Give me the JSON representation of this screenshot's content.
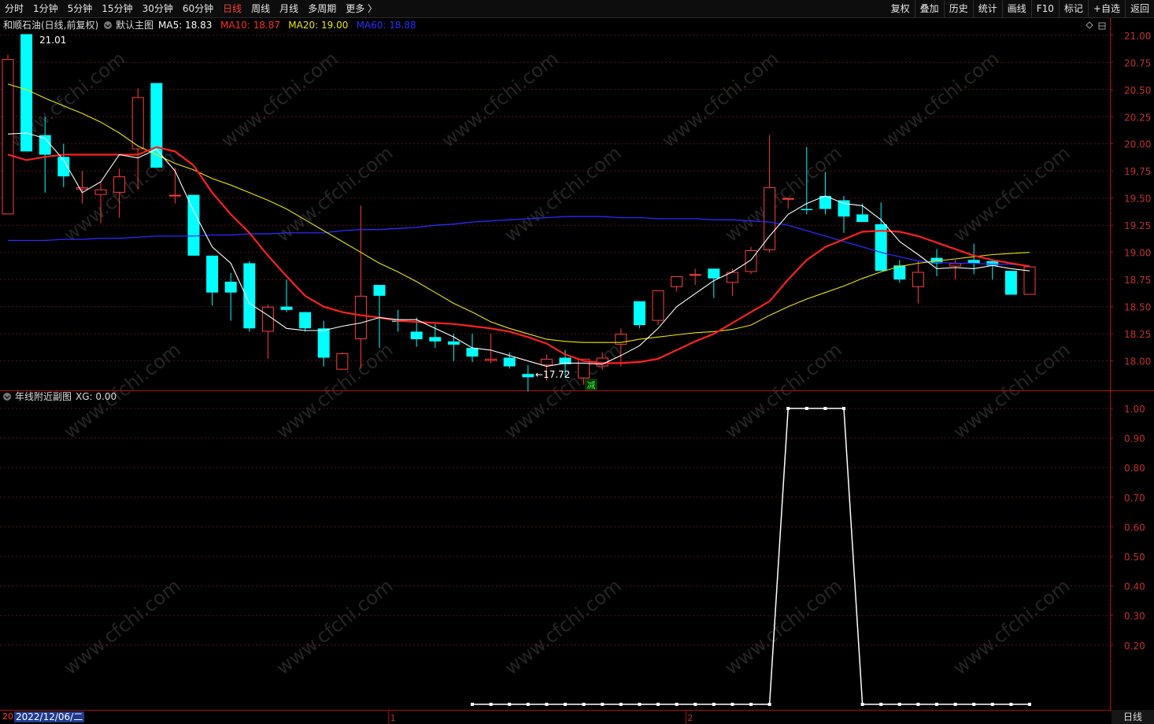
{
  "toolbar": {
    "periods": [
      "分时",
      "1分钟",
      "5分钟",
      "15分钟",
      "30分钟",
      "60分钟",
      "日线",
      "周线",
      "月线",
      "多周期",
      "更多 〉"
    ],
    "active_period": "日线",
    "actions": [
      "复权",
      "叠加",
      "历史",
      "统计",
      "画线",
      "F10",
      "标记",
      "+自选",
      "返回"
    ]
  },
  "main_panel": {
    "stock_title": "和顺石油(日线,前复权)",
    "template_name": "默认主图",
    "ma_labels": [
      {
        "text": "MA5: 18.83",
        "color": "#ffffff"
      },
      {
        "text": "MA10: 18.87",
        "color": "#ff2a2a"
      },
      {
        "text": "MA20: 19.00",
        "color": "#e8e800"
      },
      {
        "text": "MA60: 18.88",
        "color": "#2c2cff"
      }
    ],
    "high_marker": "21.01",
    "low_marker": "←17.72",
    "reduce_tag": "减"
  },
  "sub_panel": {
    "title": "年线附近副图",
    "value_text": "XG: 0.00"
  },
  "bottom": {
    "date_prefix": "20",
    "date_label": "2022/12/06/二",
    "month_marks": [
      "1",
      "2"
    ],
    "period_label": "日线"
  },
  "watermark": "www.cfchi.com",
  "chart_data": [
    {
      "type": "candlestick",
      "y_axis_ticks": [
        "21.00",
        "20.75",
        "20.50",
        "20.25",
        "20.00",
        "19.75",
        "19.50",
        "19.25",
        "19.00",
        "18.75",
        "18.50",
        "18.25",
        "18.00"
      ],
      "ylim": [
        17.78,
        21.1
      ],
      "candles": [
        {
          "o": 19.35,
          "h": 20.82,
          "l": 19.35,
          "c": 20.78,
          "dir": "up"
        },
        {
          "o": 21.01,
          "h": 21.01,
          "l": 19.93,
          "c": 19.93,
          "dir": "down"
        },
        {
          "o": 20.08,
          "h": 20.25,
          "l": 19.55,
          "c": 19.9,
          "dir": "down"
        },
        {
          "o": 19.88,
          "h": 20.0,
          "l": 19.6,
          "c": 19.7,
          "dir": "down"
        },
        {
          "o": 19.6,
          "h": 19.75,
          "l": 19.45,
          "c": 19.58,
          "dir": "up"
        },
        {
          "o": 19.53,
          "h": 19.65,
          "l": 19.27,
          "c": 19.58,
          "dir": "up"
        },
        {
          "o": 19.55,
          "h": 19.77,
          "l": 19.32,
          "c": 19.7,
          "dir": "up"
        },
        {
          "o": 19.95,
          "h": 20.51,
          "l": 19.58,
          "c": 20.43,
          "dir": "up"
        },
        {
          "o": 20.56,
          "h": 20.56,
          "l": 19.78,
          "c": 19.78,
          "dir": "down"
        },
        {
          "o": 19.52,
          "h": 19.78,
          "l": 19.45,
          "c": 19.53,
          "dir": "up"
        },
        {
          "o": 19.53,
          "h": 19.53,
          "l": 18.97,
          "c": 18.97,
          "dir": "down"
        },
        {
          "o": 18.97,
          "h": 18.97,
          "l": 18.51,
          "c": 18.63,
          "dir": "down"
        },
        {
          "o": 18.73,
          "h": 18.81,
          "l": 18.37,
          "c": 18.63,
          "dir": "down"
        },
        {
          "o": 18.9,
          "h": 18.92,
          "l": 18.27,
          "c": 18.3,
          "dir": "down"
        },
        {
          "o": 18.27,
          "h": 18.52,
          "l": 18.02,
          "c": 18.5,
          "dir": "up"
        },
        {
          "o": 18.5,
          "h": 18.75,
          "l": 18.45,
          "c": 18.47,
          "dir": "down"
        },
        {
          "o": 18.45,
          "h": 18.45,
          "l": 18.27,
          "c": 18.3,
          "dir": "down"
        },
        {
          "o": 18.3,
          "h": 18.37,
          "l": 17.95,
          "c": 18.03,
          "dir": "down"
        },
        {
          "o": 17.92,
          "h": 18.08,
          "l": 17.92,
          "c": 18.07,
          "dir": "up"
        },
        {
          "o": 18.2,
          "h": 19.43,
          "l": 17.93,
          "c": 18.6,
          "dir": "up"
        },
        {
          "o": 18.7,
          "h": 18.7,
          "l": 18.12,
          "c": 18.6,
          "dir": "down"
        },
        {
          "o": 18.37,
          "h": 18.47,
          "l": 18.27,
          "c": 18.37,
          "dir": "down"
        },
        {
          "o": 18.27,
          "h": 18.4,
          "l": 18.13,
          "c": 18.2,
          "dir": "down"
        },
        {
          "o": 18.22,
          "h": 18.34,
          "l": 18.12,
          "c": 18.18,
          "dir": "down"
        },
        {
          "o": 18.18,
          "h": 18.25,
          "l": 18.0,
          "c": 18.15,
          "dir": "down"
        },
        {
          "o": 18.12,
          "h": 18.25,
          "l": 17.99,
          "c": 18.04,
          "dir": "down"
        },
        {
          "o": 18.0,
          "h": 18.25,
          "l": 17.98,
          "c": 18.02,
          "dir": "up"
        },
        {
          "o": 18.03,
          "h": 18.08,
          "l": 17.93,
          "c": 17.95,
          "dir": "down"
        },
        {
          "o": 17.88,
          "h": 17.96,
          "l": 17.72,
          "c": 17.85,
          "dir": "down"
        },
        {
          "o": 17.96,
          "h": 18.06,
          "l": 17.82,
          "c": 18.02,
          "dir": "up"
        },
        {
          "o": 18.03,
          "h": 18.1,
          "l": 17.85,
          "c": 17.97,
          "dir": "down"
        },
        {
          "o": 17.84,
          "h": 18.02,
          "l": 17.78,
          "c": 18.02,
          "dir": "up"
        },
        {
          "o": 18.03,
          "h": 18.08,
          "l": 17.92,
          "c": 17.95,
          "dir": "up"
        },
        {
          "o": 18.15,
          "h": 18.3,
          "l": 17.95,
          "c": 18.25,
          "dir": "up"
        },
        {
          "o": 18.33,
          "h": 18.55,
          "l": 18.3,
          "c": 18.55,
          "dir": "down"
        },
        {
          "o": 18.37,
          "h": 18.65,
          "l": 18.33,
          "c": 18.65,
          "dir": "up"
        },
        {
          "o": 18.68,
          "h": 18.78,
          "l": 18.64,
          "c": 18.78,
          "dir": "up"
        },
        {
          "o": 18.8,
          "h": 18.85,
          "l": 18.7,
          "c": 18.8,
          "dir": "up"
        },
        {
          "o": 18.85,
          "h": 18.85,
          "l": 18.58,
          "c": 18.76,
          "dir": "down"
        },
        {
          "o": 18.72,
          "h": 18.85,
          "l": 18.6,
          "c": 18.82,
          "dir": "up"
        },
        {
          "o": 18.82,
          "h": 19.05,
          "l": 18.8,
          "c": 19.02,
          "dir": "up"
        },
        {
          "o": 19.02,
          "h": 20.08,
          "l": 19.0,
          "c": 19.6,
          "dir": "up"
        },
        {
          "o": 19.5,
          "h": 19.5,
          "l": 19.4,
          "c": 19.5,
          "dir": "up"
        },
        {
          "o": 19.4,
          "h": 19.97,
          "l": 19.35,
          "c": 19.4,
          "dir": "down"
        },
        {
          "o": 19.52,
          "h": 19.74,
          "l": 19.35,
          "c": 19.4,
          "dir": "down"
        },
        {
          "o": 19.48,
          "h": 19.52,
          "l": 19.18,
          "c": 19.33,
          "dir": "down"
        },
        {
          "o": 19.35,
          "h": 19.45,
          "l": 19.28,
          "c": 19.28,
          "dir": "down"
        },
        {
          "o": 19.26,
          "h": 19.46,
          "l": 18.83,
          "c": 18.83,
          "dir": "down"
        },
        {
          "o": 18.88,
          "h": 18.93,
          "l": 18.72,
          "c": 18.75,
          "dir": "down"
        },
        {
          "o": 18.68,
          "h": 18.92,
          "l": 18.53,
          "c": 18.82,
          "dir": "up"
        },
        {
          "o": 18.95,
          "h": 19.03,
          "l": 18.78,
          "c": 18.9,
          "dir": "down"
        },
        {
          "o": 18.87,
          "h": 18.93,
          "l": 18.75,
          "c": 18.9,
          "dir": "up"
        },
        {
          "o": 18.93,
          "h": 19.08,
          "l": 18.8,
          "c": 18.9,
          "dir": "down"
        },
        {
          "o": 18.92,
          "h": 18.92,
          "l": 18.75,
          "c": 18.88,
          "dir": "down"
        },
        {
          "o": 18.83,
          "h": 18.83,
          "l": 18.61,
          "c": 18.61,
          "dir": "down"
        },
        {
          "o": 18.61,
          "h": 18.87,
          "l": 18.61,
          "c": 18.87,
          "dir": "up"
        }
      ],
      "ma5": [
        20.09,
        20.1,
        20.05,
        19.85,
        19.55,
        19.65,
        19.9,
        19.87,
        19.95,
        19.75,
        19.38,
        19.05,
        18.9,
        18.53,
        18.42,
        18.3,
        18.28,
        18.28,
        18.32,
        18.35,
        18.4,
        18.38,
        18.38,
        18.3,
        18.22,
        18.12,
        18.1,
        18.05,
        18.0,
        17.95,
        17.98,
        17.98,
        17.97,
        18.05,
        18.14,
        18.3,
        18.5,
        18.62,
        18.74,
        18.82,
        18.93,
        19.15,
        19.35,
        19.45,
        19.52,
        19.45,
        19.43,
        19.3,
        19.1,
        18.98,
        18.85,
        18.86,
        18.85,
        18.88,
        18.85,
        18.83
      ],
      "ma10": [
        19.9,
        19.85,
        19.88,
        19.9,
        19.9,
        19.9,
        19.9,
        19.9,
        19.97,
        19.93,
        19.8,
        19.55,
        19.35,
        19.18,
        18.97,
        18.78,
        18.6,
        18.5,
        18.45,
        18.42,
        18.4,
        18.37,
        18.36,
        18.35,
        18.34,
        18.32,
        18.3,
        18.27,
        18.22,
        18.16,
        18.06,
        18.0,
        17.98,
        17.98,
        17.99,
        18.02,
        18.1,
        18.18,
        18.25,
        18.35,
        18.45,
        18.55,
        18.75,
        18.93,
        19.05,
        19.12,
        19.19,
        19.2,
        19.19,
        19.15,
        19.09,
        19.03,
        18.97,
        18.93,
        18.9,
        18.87
      ],
      "ma20": [
        20.55,
        20.5,
        20.42,
        20.35,
        20.28,
        20.2,
        20.1,
        19.98,
        19.9,
        19.82,
        19.76,
        19.68,
        19.62,
        19.55,
        19.48,
        19.4,
        19.3,
        19.2,
        19.1,
        19.0,
        18.9,
        18.82,
        18.73,
        18.63,
        18.53,
        18.45,
        18.36,
        18.3,
        18.25,
        18.2,
        18.18,
        18.17,
        18.17,
        18.17,
        18.2,
        18.22,
        18.24,
        18.26,
        18.27,
        18.29,
        18.33,
        18.42,
        18.5,
        18.57,
        18.63,
        18.69,
        18.76,
        18.82,
        18.87,
        18.9,
        18.92,
        18.94,
        18.96,
        18.98,
        18.99,
        19.0
      ],
      "ma60": [
        19.11,
        19.11,
        19.11,
        19.12,
        19.12,
        19.13,
        19.13,
        19.14,
        19.15,
        19.15,
        19.15,
        19.16,
        19.16,
        19.17,
        19.17,
        19.18,
        19.18,
        19.18,
        19.2,
        19.21,
        19.21,
        19.22,
        19.23,
        19.25,
        19.26,
        19.28,
        19.29,
        19.3,
        19.31,
        19.32,
        19.33,
        19.33,
        19.33,
        19.32,
        19.32,
        19.31,
        19.31,
        19.31,
        19.3,
        19.3,
        19.29,
        19.28,
        19.25,
        19.2,
        19.15,
        19.1,
        19.05,
        19.0,
        18.96,
        18.92,
        18.91,
        18.9,
        18.9,
        18.89,
        18.89,
        18.88
      ]
    },
    {
      "type": "line",
      "series_name": "XG",
      "y_axis_ticks": [
        "1.00",
        "0.90",
        "0.80",
        "0.70",
        "0.60",
        "0.50",
        "0.40",
        "0.30",
        "0.20"
      ],
      "ylim": [
        0,
        1.0
      ],
      "start_index": 25,
      "values": [
        0,
        0,
        0,
        0,
        0,
        0,
        0,
        0,
        0,
        0,
        0,
        0,
        0,
        0,
        0,
        0,
        0,
        1,
        1,
        1,
        1,
        0,
        0,
        0,
        0,
        0,
        0,
        0,
        0,
        0,
        0
      ]
    }
  ]
}
